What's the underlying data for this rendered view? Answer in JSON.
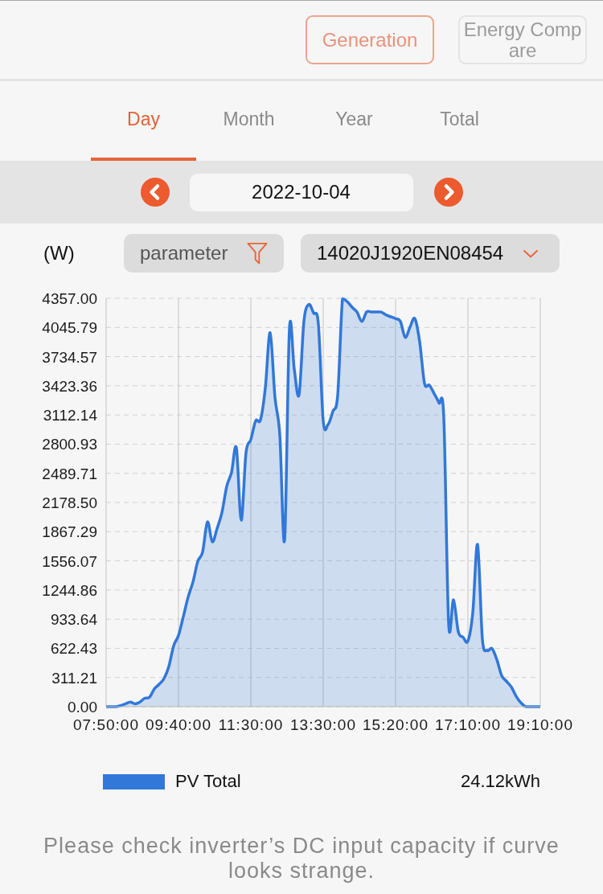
{
  "header": {
    "buttons": [
      {
        "label": "Generation",
        "selected": true
      },
      {
        "label": "Energy Compare",
        "selected": false
      }
    ]
  },
  "tabs": [
    {
      "label": "Day",
      "selected": true
    },
    {
      "label": "Month",
      "selected": false
    },
    {
      "label": "Year",
      "selected": false
    },
    {
      "label": "Total",
      "selected": false
    }
  ],
  "date_bar": {
    "date": "2022-10-04"
  },
  "filters": {
    "unit": "(W)",
    "parameter": "parameter",
    "device": "14020J1920EN08454"
  },
  "chart": {
    "chart_data": {
      "type": "area",
      "grid": true,
      "categories": [
        "07:50:00",
        null,
        null,
        null,
        null,
        null,
        null,
        null,
        null,
        null,
        null,
        null,
        null,
        null,
        null,
        "09:40:00",
        null,
        null,
        null,
        null,
        null,
        null,
        null,
        null,
        null,
        null,
        null,
        null,
        null,
        null,
        "11:30:00",
        null,
        null,
        null,
        null,
        null,
        null,
        null,
        null,
        null,
        null,
        null,
        null,
        null,
        null,
        "13:30:00",
        null,
        null,
        null,
        null,
        null,
        null,
        null,
        null,
        null,
        null,
        null,
        null,
        null,
        null,
        "15:20:00",
        null,
        null,
        null,
        null,
        null,
        null,
        null,
        null,
        null,
        null,
        null,
        null,
        null,
        null,
        "17:10:00",
        null,
        null,
        null,
        null,
        null,
        null,
        null,
        null,
        null,
        null,
        null,
        null,
        null,
        null,
        "19:10:00"
      ],
      "series": [
        {
          "name": "PV Total",
          "color": "#3178d8",
          "values": [
            0,
            0,
            0,
            10,
            30,
            50,
            30,
            50,
            90,
            100,
            190,
            240,
            300,
            430,
            650,
            760,
            960,
            1170,
            1330,
            1550,
            1650,
            1970,
            1760,
            1900,
            2070,
            2350,
            2500,
            2760,
            1990,
            2710,
            2850,
            3050,
            3060,
            3400,
            3990,
            3300,
            2900,
            1780,
            4030,
            3600,
            3330,
            4110,
            4290,
            4200,
            4080,
            3050,
            3010,
            3150,
            3320,
            4350,
            4320,
            4260,
            4210,
            4110,
            4210,
            4210,
            4210,
            4210,
            4180,
            4160,
            4140,
            4110,
            3940,
            4050,
            4140,
            3890,
            3450,
            3430,
            3340,
            3240,
            3080,
            890,
            1140,
            800,
            740,
            700,
            1000,
            1730,
            720,
            600,
            620,
            500,
            330,
            270,
            210,
            110,
            40,
            0,
            0,
            0,
            0
          ]
        }
      ],
      "ylim": [
        0,
        4357
      ],
      "yticks": [
        {
          "value": 0,
          "label": "0.00"
        },
        {
          "value": 311.21,
          "label": "311.21"
        },
        {
          "value": 622.43,
          "label": "622.43"
        },
        {
          "value": 933.64,
          "label": "933.64"
        },
        {
          "value": 1244.86,
          "label": "1244.86"
        },
        {
          "value": 1556.07,
          "label": "1556.07"
        },
        {
          "value": 1867.29,
          "label": "1867.29"
        },
        {
          "value": 2178.5,
          "label": "2178.50"
        },
        {
          "value": 2489.71,
          "label": "2489.71"
        },
        {
          "value": 2800.93,
          "label": "2800.93"
        },
        {
          "value": 3112.14,
          "label": "3112.14"
        },
        {
          "value": 3423.36,
          "label": "3423.36"
        },
        {
          "value": 3734.57,
          "label": "3734.57"
        },
        {
          "value": 4045.79,
          "label": "4045.79"
        },
        {
          "value": 4357,
          "label": "4357.00"
        }
      ]
    },
    "total": "24.12kWh"
  },
  "note": "Please check inverter’s DC input capacity if curve looks strange."
}
